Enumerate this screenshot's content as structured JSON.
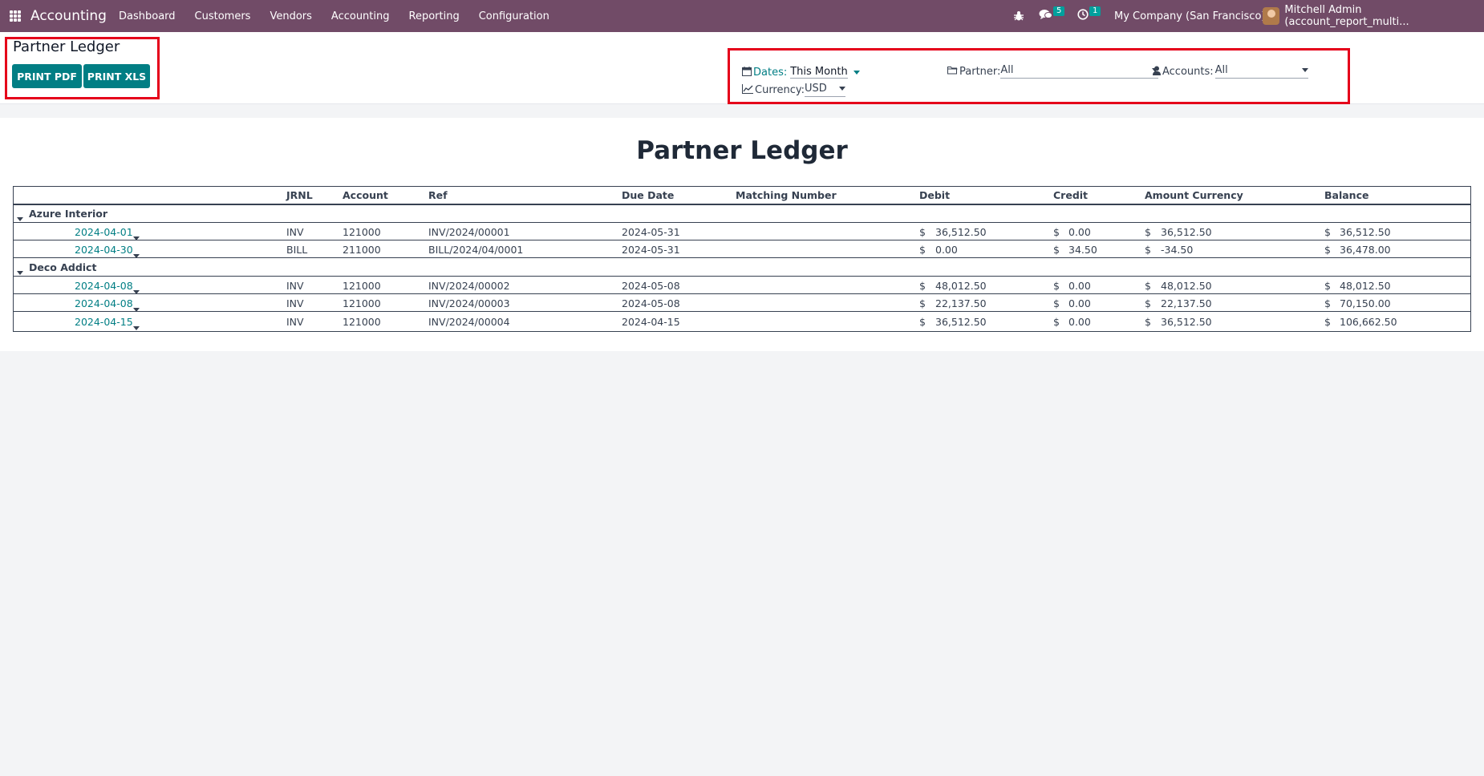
{
  "navbar": {
    "brand": "Accounting",
    "menu": [
      "Dashboard",
      "Customers",
      "Vendors",
      "Accounting",
      "Reporting",
      "Configuration"
    ],
    "messages_count": "5",
    "activities_count": "1",
    "company": "My Company (San Francisco)",
    "user": "Mitchell Admin (account_report_multi..."
  },
  "control_panel": {
    "title": "Partner Ledger",
    "print_pdf": "PRINT PDF",
    "print_xls": "PRINT XLS",
    "filters": {
      "dates_label": "Dates:",
      "dates_value": "This Month",
      "partner_label": "Partner:",
      "partner_value": "All",
      "accounts_label": "Accounts:",
      "accounts_value": "All",
      "currency_label": "Currency:",
      "currency_value": "USD"
    }
  },
  "report": {
    "title": "Partner Ledger",
    "columns": [
      "JRNL",
      "Account",
      "Ref",
      "Due Date",
      "Matching Number",
      "Debit",
      "Credit",
      "Amount Currency",
      "Balance"
    ],
    "currency_symbol": "$",
    "groups": [
      {
        "name": "Azure Interior",
        "lines": [
          {
            "date": "2024-04-01",
            "jrnl": "INV",
            "account": "121000",
            "ref": "INV/2024/00001",
            "due": "2024-05-31",
            "matching": "",
            "debit": "36,512.50",
            "credit": "0.00",
            "amount_currency": "36,512.50",
            "balance": "36,512.50"
          },
          {
            "date": "2024-04-30",
            "jrnl": "BILL",
            "account": "211000",
            "ref": "BILL/2024/04/0001",
            "due": "2024-05-31",
            "matching": "",
            "debit": "0.00",
            "credit": "34.50",
            "amount_currency": "-34.50",
            "balance": "36,478.00"
          }
        ]
      },
      {
        "name": "Deco Addict",
        "lines": [
          {
            "date": "2024-04-08",
            "jrnl": "INV",
            "account": "121000",
            "ref": "INV/2024/00002",
            "due": "2024-05-08",
            "matching": "",
            "debit": "48,012.50",
            "credit": "0.00",
            "amount_currency": "48,012.50",
            "balance": "48,012.50"
          },
          {
            "date": "2024-04-08",
            "jrnl": "INV",
            "account": "121000",
            "ref": "INV/2024/00003",
            "due": "2024-05-08",
            "matching": "",
            "debit": "22,137.50",
            "credit": "0.00",
            "amount_currency": "22,137.50",
            "balance": "70,150.00"
          },
          {
            "date": "2024-04-15",
            "jrnl": "INV",
            "account": "121000",
            "ref": "INV/2024/00004",
            "due": "2024-04-15",
            "matching": "",
            "debit": "36,512.50",
            "credit": "0.00",
            "amount_currency": "36,512.50",
            "balance": "106,662.50"
          }
        ]
      }
    ]
  }
}
